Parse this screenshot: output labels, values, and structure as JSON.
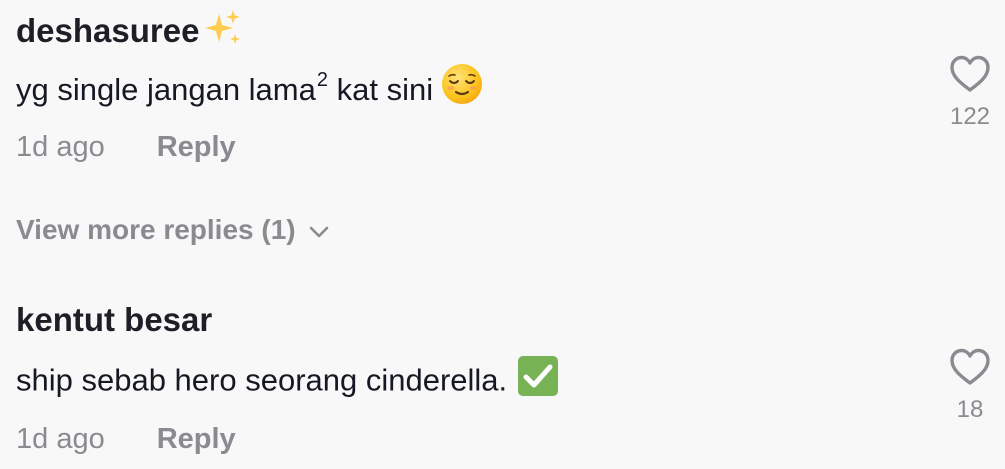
{
  "comments": [
    {
      "username": "deshasuree",
      "text_before": "yg single jangan lama",
      "superscript": "2",
      "text_after": " kat sini",
      "time": "1d ago",
      "reply_label": "Reply",
      "likes": "122"
    },
    {
      "username": "kentut besar",
      "text": "ship sebab hero seorang cinderella.",
      "time": "1d ago",
      "reply_label": "Reply",
      "likes": "18"
    }
  ],
  "view_more": {
    "label": "View more replies (1)"
  },
  "colors": {
    "background": "#f8f8f8",
    "primary_text": "#161823",
    "secondary_text": "#8a8b91",
    "check_green": "#77b255",
    "sparkle_yellow": "#ffcc4d"
  },
  "icons": [
    "sparkles-icon",
    "relieved-emoji-icon",
    "check-emoji-icon",
    "heart-icon",
    "chevron-down-icon"
  ]
}
